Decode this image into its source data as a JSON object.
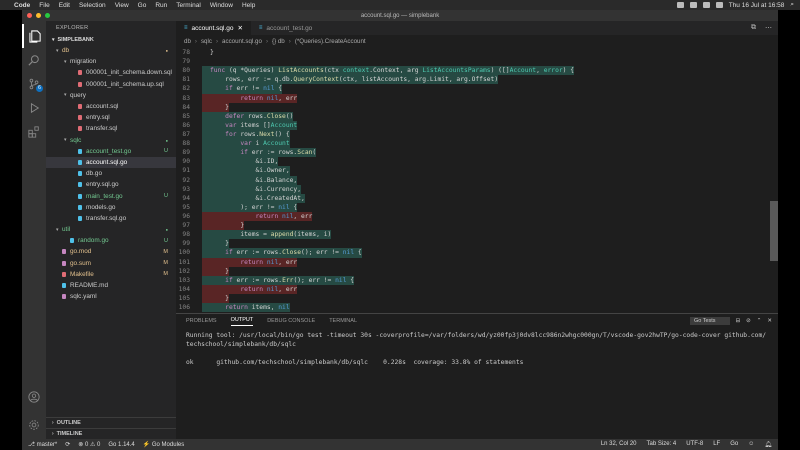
{
  "menubar": {
    "apple": "",
    "items": [
      "Code",
      "File",
      "Edit",
      "Selection",
      "View",
      "Go",
      "Run",
      "Terminal",
      "Window",
      "Help"
    ],
    "title": "account.sql.go — simplebank",
    "clock": "Thu 16 Jul at 16:58"
  },
  "sidebar": {
    "title": "EXPLORER",
    "section": "SIMPLEBANK",
    "tree": [
      {
        "label": "db",
        "indent": 0,
        "folder": true,
        "badge": "",
        "color": "#e2c08d"
      },
      {
        "label": "migration",
        "indent": 1,
        "folder": true,
        "badge": "",
        "color": "#ccc"
      },
      {
        "label": "000001_init_schema.down.sql",
        "indent": 2,
        "folder": false,
        "badge": "",
        "color": "#ccc",
        "icon": "#e06c75"
      },
      {
        "label": "000001_init_schema.up.sql",
        "indent": 2,
        "folder": false,
        "badge": "",
        "color": "#ccc",
        "icon": "#e06c75"
      },
      {
        "label": "query",
        "indent": 1,
        "folder": true,
        "badge": "",
        "color": "#ccc"
      },
      {
        "label": "account.sql",
        "indent": 2,
        "folder": false,
        "badge": "",
        "color": "#ccc",
        "icon": "#e06c75"
      },
      {
        "label": "entry.sql",
        "indent": 2,
        "folder": false,
        "badge": "",
        "color": "#ccc",
        "icon": "#e06c75"
      },
      {
        "label": "transfer.sql",
        "indent": 2,
        "folder": false,
        "badge": "",
        "color": "#ccc",
        "icon": "#e06c75"
      },
      {
        "label": "sqlc",
        "indent": 1,
        "folder": true,
        "badge": "",
        "color": "#73c991"
      },
      {
        "label": "account_test.go",
        "indent": 2,
        "folder": false,
        "badge": "U",
        "color": "#73c991",
        "icon": "#4fc1e9"
      },
      {
        "label": "account.sql.go",
        "indent": 2,
        "folder": false,
        "badge": "",
        "color": "#fff",
        "icon": "#4fc1e9",
        "selected": true
      },
      {
        "label": "db.go",
        "indent": 2,
        "folder": false,
        "badge": "",
        "color": "#ccc",
        "icon": "#4fc1e9"
      },
      {
        "label": "entry.sql.go",
        "indent": 2,
        "folder": false,
        "badge": "",
        "color": "#ccc",
        "icon": "#4fc1e9"
      },
      {
        "label": "main_test.go",
        "indent": 2,
        "folder": false,
        "badge": "U",
        "color": "#73c991",
        "icon": "#4fc1e9"
      },
      {
        "label": "models.go",
        "indent": 2,
        "folder": false,
        "badge": "",
        "color": "#ccc",
        "icon": "#4fc1e9"
      },
      {
        "label": "transfer.sql.go",
        "indent": 2,
        "folder": false,
        "badge": "",
        "color": "#ccc",
        "icon": "#4fc1e9"
      },
      {
        "label": "util",
        "indent": 0,
        "folder": true,
        "badge": "",
        "color": "#73c991"
      },
      {
        "label": "random.go",
        "indent": 1,
        "folder": false,
        "badge": "U",
        "color": "#73c991",
        "icon": "#4fc1e9"
      },
      {
        "label": "go.mod",
        "indent": 0,
        "folder": false,
        "badge": "M",
        "color": "#e2c08d",
        "icon": "#c586c0"
      },
      {
        "label": "go.sum",
        "indent": 0,
        "folder": false,
        "badge": "M",
        "color": "#e2c08d",
        "icon": "#c586c0"
      },
      {
        "label": "Makefile",
        "indent": 0,
        "folder": false,
        "badge": "M",
        "color": "#e2c08d",
        "icon": "#e06c75"
      },
      {
        "label": "README.md",
        "indent": 0,
        "folder": false,
        "badge": "",
        "color": "#ccc",
        "icon": "#4fc1e9"
      },
      {
        "label": "sqlc.yaml",
        "indent": 0,
        "folder": false,
        "badge": "",
        "color": "#ccc",
        "icon": "#c586c0"
      }
    ],
    "outline": "OUTLINE",
    "timeline": "TIMELINE"
  },
  "editor": {
    "tabs": [
      {
        "label": "account.sql.go",
        "active": true,
        "close": "✕"
      },
      {
        "label": "account_test.go",
        "active": false,
        "close": ""
      }
    ],
    "breadcrumb": [
      "db",
      "sqlc",
      "account.sql.go",
      "{} db",
      "(*Queries).CreateAccount"
    ],
    "lines": [
      {
        "n": "78",
        "t": "}",
        "cov": ""
      },
      {
        "n": "79",
        "t": "",
        "cov": ""
      },
      {
        "n": "80",
        "t": "func (q *Queries) ListAccounts(ctx context.Context, arg ListAccountsParams) ([]Account, error) {",
        "cov": "c"
      },
      {
        "n": "81",
        "t": "    rows, err := q.db.QueryContext(ctx, listAccounts, arg.Limit, arg.Offset)",
        "cov": "c"
      },
      {
        "n": "82",
        "t": "    if err != nil {",
        "cov": "c"
      },
      {
        "n": "83",
        "t": "        return nil, err",
        "cov": "u"
      },
      {
        "n": "84",
        "t": "    }",
        "cov": "u"
      },
      {
        "n": "85",
        "t": "    defer rows.Close()",
        "cov": "c"
      },
      {
        "n": "86",
        "t": "    var items []Account",
        "cov": "c"
      },
      {
        "n": "87",
        "t": "    for rows.Next() {",
        "cov": "c"
      },
      {
        "n": "88",
        "t": "        var i Account",
        "cov": "c"
      },
      {
        "n": "89",
        "t": "        if err := rows.Scan(",
        "cov": "c"
      },
      {
        "n": "90",
        "t": "            &i.ID,",
        "cov": "c"
      },
      {
        "n": "91",
        "t": "            &i.Owner,",
        "cov": "c"
      },
      {
        "n": "92",
        "t": "            &i.Balance,",
        "cov": "c"
      },
      {
        "n": "93",
        "t": "            &i.Currency,",
        "cov": "c"
      },
      {
        "n": "94",
        "t": "            &i.CreatedAt,",
        "cov": "c"
      },
      {
        "n": "95",
        "t": "        ); err != nil {",
        "cov": "c"
      },
      {
        "n": "96",
        "t": "            return nil, err",
        "cov": "u"
      },
      {
        "n": "97",
        "t": "        }",
        "cov": "u"
      },
      {
        "n": "98",
        "t": "        items = append(items, i)",
        "cov": "c"
      },
      {
        "n": "99",
        "t": "    }",
        "cov": "c"
      },
      {
        "n": "100",
        "t": "    if err := rows.Close(); err != nil {",
        "cov": "c"
      },
      {
        "n": "101",
        "t": "        return nil, err",
        "cov": "u"
      },
      {
        "n": "102",
        "t": "    }",
        "cov": "u"
      },
      {
        "n": "103",
        "t": "    if err := rows.Err(); err != nil {",
        "cov": "c"
      },
      {
        "n": "104",
        "t": "        return nil, err",
        "cov": "u"
      },
      {
        "n": "105",
        "t": "    }",
        "cov": "u"
      },
      {
        "n": "106",
        "t": "    return items, nil",
        "cov": "c"
      }
    ]
  },
  "panel": {
    "tabs": [
      "PROBLEMS",
      "OUTPUT",
      "DEBUG CONSOLE",
      "TERMINAL"
    ],
    "active": "OUTPUT",
    "dropdown": "Go Tests",
    "output": [
      "Running tool: /usr/local/bin/go test -timeout 30s -coverprofile=/var/folders/wd/yz00fp3j0dv8lcc986n2whgc000gn/T/vscode-gov2hwTP/go-code-cover github.com/",
      "techschool/simplebank/db/sqlc",
      "",
      "ok      github.com/techschool/simplebank/db/sqlc    0.228s  coverage: 33.8% of statements"
    ]
  },
  "statusbar": {
    "branch": "master*",
    "sync": "⟳",
    "problems": "⊗ 0 ⚠ 0",
    "go_version": "Go 1.14.4",
    "go_modules": "Go Modules",
    "position": "Ln 32, Col 20",
    "tab_size": "Tab Size: 4",
    "encoding": "UTF-8",
    "eol": "LF",
    "language": "Go"
  },
  "colors": {
    "covered": "#2a5a50",
    "uncovered": "#6e2828",
    "accent": "#4fc1e9"
  }
}
